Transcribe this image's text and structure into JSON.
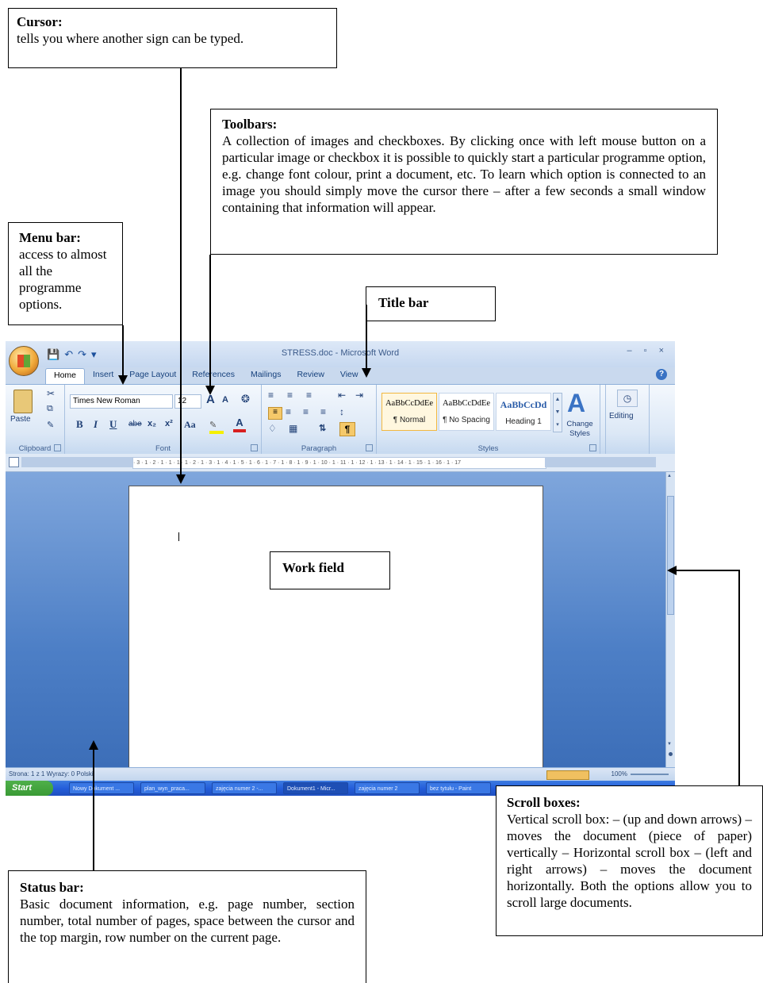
{
  "callouts": {
    "cursor": {
      "title": "Cursor:",
      "body": "tells you where another sign can be typed."
    },
    "toolbars": {
      "title": "Toolbars:",
      "body": "A collection of images and checkboxes. By clicking once with left mouse button on a particular image or checkbox it is possible to quickly start a particular programme option, e.g. change font colour, print a document, etc. To learn which option is connected to an image you should simply move the cursor there – after a few seconds a small window containing that information will appear."
    },
    "menu_bar": {
      "title": "Menu bar:",
      "body": "access to almost all the programme options."
    },
    "title_bar": {
      "title": "Title bar"
    },
    "work_field": {
      "title": "Work field"
    },
    "scroll_boxes": {
      "title": "Scroll boxes:",
      "body": "Vertical scroll box: – (up and down arrows) – moves the document (piece of paper) vertically – Horizontal scroll box – (left and right arrows) – moves the document horizontally. Both the options allow you to scroll large documents."
    },
    "status_bar": {
      "title": "Status bar:",
      "body": "Basic document information, e.g. page number, section number, total number of pages, space between the cursor and the top margin, row number on the current page."
    }
  },
  "word": {
    "window_title": "STRESS.doc - Microsoft Word",
    "window_controls": "– ▫ ×",
    "tabs": [
      "Home",
      "Insert",
      "Page Layout",
      "References",
      "Mailings",
      "Review",
      "View"
    ],
    "clipboard": {
      "paste": "Paste",
      "label": "Clipboard"
    },
    "font": {
      "name": "Times New Roman",
      "size": "12",
      "label": "Font",
      "bold": "B",
      "italic": "I",
      "underline": "U",
      "strike": "abe",
      "sub": "x₂",
      "sup": "x²",
      "case": "Aa",
      "grow": "A",
      "shrink": "A"
    },
    "paragraph": {
      "label": "Paragraph",
      "pilcrow": "¶"
    },
    "styles": {
      "label": "Styles",
      "items": [
        {
          "sample": "AaBbCcDdEe",
          "name": "¶ Normal"
        },
        {
          "sample": "AaBbCcDdEe",
          "name": "¶ No Spacing"
        },
        {
          "sample": "AaBbCcDd",
          "name": "Heading 1"
        }
      ],
      "change_styles": "Change Styles"
    },
    "editing": "Editing",
    "ruler_marks": "· 3 · 1 · 2 · 1 · 1 · 1 · 1 · 2 · 1 · 3 · 1 · 4 · 1 · 5 · 1 · 6 · 1 · 7 · 1 · 8 · 1 · 9 · 1 · 10 · 1 · 11 · 1 · 12 · 1 · 13 · 1 · 14 · 1 · 15 · 1 · 16 · 1 · 17",
    "status": {
      "text": "Strona: 1 z 1   Wyrazy: 0   Polski",
      "zoom": "100%"
    },
    "taskbar": {
      "start": "Start",
      "tasks": [
        "Nowy Dokument ...",
        "plan_wyn_praca...",
        "zajęcia numer 2 -...",
        "Dokument1 - Micr...",
        "zajęcia numer 2",
        "bez tytułu - Paint"
      ]
    }
  }
}
